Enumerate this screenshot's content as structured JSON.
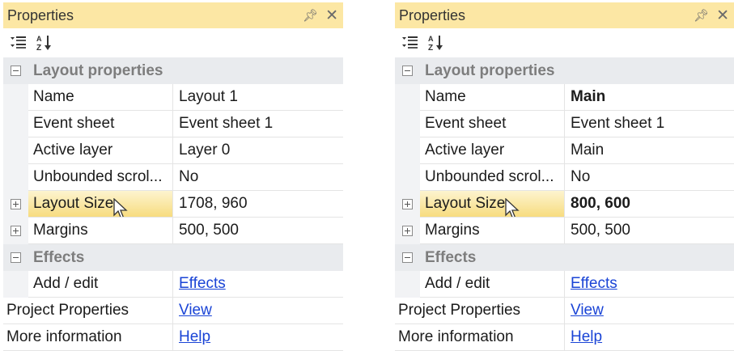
{
  "left_panel": {
    "title": "Properties",
    "pin_icon": "pin-icon",
    "close_icon": "close-icon",
    "sections": {
      "layout_category": "Layout properties",
      "name_label": "Name",
      "name_value": "Layout 1",
      "event_sheet_label": "Event sheet",
      "event_sheet_value": "Event sheet 1",
      "active_layer_label": "Active layer",
      "active_layer_value": "Layer 0",
      "unbounded_label": "Unbounded scrol...",
      "unbounded_value": "No",
      "layout_size_label": "Layout Size",
      "layout_size_value": "1708, 960",
      "margins_label": "Margins",
      "margins_value": "500, 500",
      "effects_category": "Effects",
      "add_edit_label": "Add / edit",
      "add_edit_link": "Effects",
      "project_label": "Project Properties",
      "project_link": "View",
      "more_label": "More information",
      "more_link": "Help"
    }
  },
  "right_panel": {
    "title": "Properties",
    "pin_icon": "pin-icon",
    "close_icon": "close-icon",
    "sections": {
      "layout_category": "Layout properties",
      "name_label": "Name",
      "name_value": "Main",
      "event_sheet_label": "Event sheet",
      "event_sheet_value": "Event sheet 1",
      "active_layer_label": "Active layer",
      "active_layer_value": "Main",
      "unbounded_label": "Unbounded scrol...",
      "unbounded_value": "No",
      "layout_size_label": "Layout Size",
      "layout_size_value": "800, 600",
      "margins_label": "Margins",
      "margins_value": "500, 500",
      "effects_category": "Effects",
      "add_edit_label": "Add / edit",
      "add_edit_link": "Effects",
      "project_label": "Project Properties",
      "project_link": "View",
      "more_label": "More information",
      "more_link": "Help"
    }
  },
  "colors": {
    "title_bar": "#fce7a4",
    "category_row": "#e9ebee",
    "selected_row": "#f7dc7f",
    "link": "#1a44d6"
  }
}
